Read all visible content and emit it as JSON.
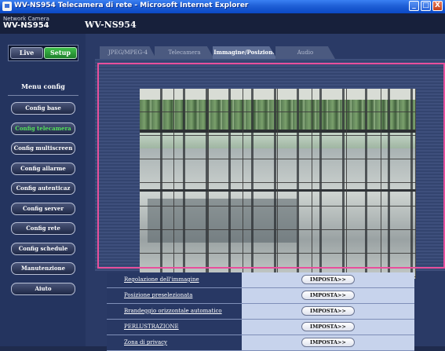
{
  "window": {
    "title": "WV-NS954 Telecamera di rete - Microsoft Internet Explorer",
    "controls": [
      "_",
      "□",
      "X"
    ]
  },
  "header": {
    "brand_small": "Network Camera",
    "brand_model": "WV-NS954",
    "model_title": "WV-NS954"
  },
  "mode": {
    "live_label": "Live",
    "setup_label": "Setup",
    "active": "Setup"
  },
  "menu": {
    "title": "Menu config",
    "items": [
      {
        "label": "Config base"
      },
      {
        "label": "Config telecamera",
        "active": true
      },
      {
        "label": "Config multiscreen"
      },
      {
        "label": "Config allarme"
      },
      {
        "label": "Config autenticaz"
      },
      {
        "label": "Config server"
      },
      {
        "label": "Config rete"
      },
      {
        "label": "Config schedule"
      },
      {
        "label": "Manutenzione"
      },
      {
        "label": "Aiuto"
      }
    ]
  },
  "tabs": [
    {
      "label": "JPEG/MPEG-4"
    },
    {
      "label": "Telecamera"
    },
    {
      "label": "Immagine/Posizione",
      "active": true
    },
    {
      "label": "Audio"
    }
  ],
  "settings": {
    "button_label": "IMPOSTA>>",
    "rows": [
      {
        "label": "Regolazione dell'immagine"
      },
      {
        "label": "Posizione preselezionata"
      },
      {
        "label": "Brandeggio orizzontale automatico"
      },
      {
        "label": "PERLUSTRAZIONE"
      },
      {
        "label": "Zona di privacy"
      }
    ]
  },
  "colors": {
    "titlebar": "#1f5fd6",
    "background": "#2a3a66",
    "active_menu_text": "#55e35d",
    "setup_button": "#1d7f2a",
    "selection_frame": "#e84f9c",
    "table_value_cell": "#c7d3ec"
  },
  "icons": [
    "ie-app-icon",
    "minimize-icon",
    "maximize-icon",
    "close-icon"
  ]
}
